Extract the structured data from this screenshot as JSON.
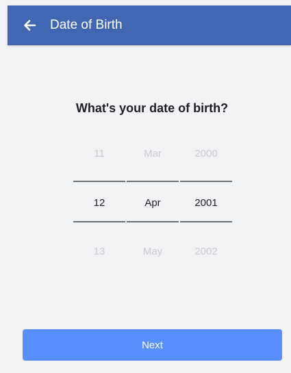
{
  "header": {
    "back_icon": "back-arrow-icon",
    "title": "Date of Birth",
    "color": "#4267b2"
  },
  "question": "What's your date of birth?",
  "picker": {
    "day": {
      "above": "11",
      "selected": "12",
      "below": "13"
    },
    "month": {
      "above": "Mar",
      "selected": "Apr",
      "below": "May"
    },
    "year": {
      "above": "2000",
      "selected": "2001",
      "below": "2002"
    }
  },
  "next_button": {
    "label": "Next",
    "color": "#5890ff"
  }
}
